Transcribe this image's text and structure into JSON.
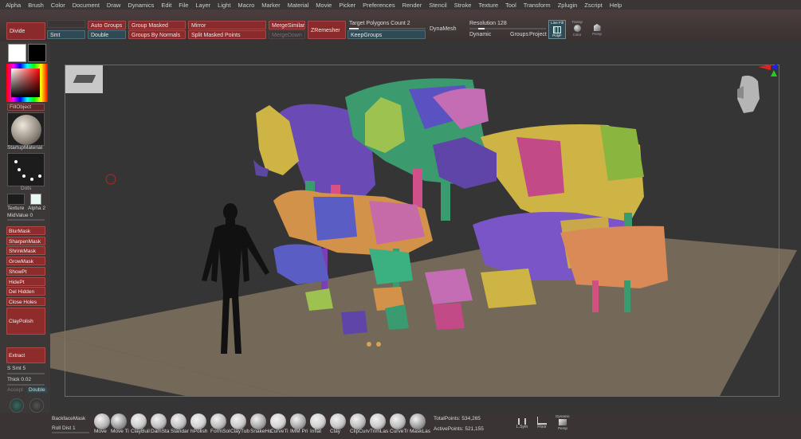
{
  "menu": [
    "Alpha",
    "Brush",
    "Color",
    "Document",
    "Draw",
    "Dynamics",
    "Edit",
    "File",
    "Layer",
    "Light",
    "Macro",
    "Marker",
    "Material",
    "Movie",
    "Picker",
    "Preferences",
    "Render",
    "Stencil",
    "Stroke",
    "Texture",
    "Tool",
    "Transform",
    "Zplugin",
    "Zscript",
    "Help"
  ],
  "shelf": {
    "divide": "Divide",
    "smt": "Smt",
    "auto_groups": "Auto Groups",
    "double": "Double",
    "group_masked": "Group Masked",
    "groups_by_normals": "Groups By Normals",
    "mirror": "Mirror",
    "split_masked_points": "Split Masked Points",
    "merge_similar": "MergeSimilar",
    "merge_down": "MergeDown",
    "zremesher": "ZRemesher",
    "target_polygons_label": "Target Polygons Count",
    "target_polygons_value": "2",
    "keep_groups": "KeepGroups",
    "dynamesh": "DynaMesh",
    "resolution_label": "Resolution",
    "resolution_value": "128",
    "dynamic": "Dynamic",
    "groups": "Groups",
    "project": "Project",
    "line_fill": "Line Fill",
    "polyf": "PolyF",
    "transp": "Transp",
    "color": "Color",
    "persp": "Persp"
  },
  "left": {
    "fill_object": "FillObject",
    "startup_material": "StartupMaterial",
    "dots": "Dots",
    "texture": "Texture",
    "alpha": "Alpha 2",
    "mid_value_label": "MidValue",
    "mid_value": "0",
    "blur_mask": "BlurMask",
    "sharpen_mask": "SharpenMask",
    "shrink_mask": "ShrinkMask",
    "grow_mask": "GrowMask",
    "show_pt": "ShowPt",
    "hide_pt": "HidePt",
    "del_hidden": "Del Hidden",
    "close_holes": "Close Holes",
    "clay_polish": "ClayPolish",
    "extract": "Extract",
    "s_smt_label": "S Smt",
    "s_smt_value": "5",
    "thick_label": "Thick",
    "thick_value": "0.02",
    "accept": "Accept",
    "double": "Double"
  },
  "bottom": {
    "backface_mask": "BackfaceMask",
    "roll_dist_label": "Roll Dist",
    "roll_dist_value": "1",
    "brushes": [
      "Move",
      "Move Ti",
      "ClayBuil",
      "DamSta",
      "Standar",
      "hPolish",
      "FormSol",
      "ClayTub",
      "SnakeHo",
      "CurveTi",
      "IMM Pri",
      "Inflat",
      "Clay",
      "ClipCurv",
      "TrimLas",
      "CurveTr",
      "MaskLas"
    ],
    "total_points_label": "TotalPoints:",
    "total_points_value": "534,265",
    "active_points_label": "ActivePoints:",
    "active_points_value": "521,155",
    "lsym": "L.Sym",
    "floor": "Floor",
    "dynamic": "Dynamic",
    "persp": "Persp"
  },
  "colors": {
    "button_red": "#8e2b2b",
    "button_teal": "#2f4a55",
    "floor": "#8a7a66",
    "viewport_bg": "#353535"
  }
}
